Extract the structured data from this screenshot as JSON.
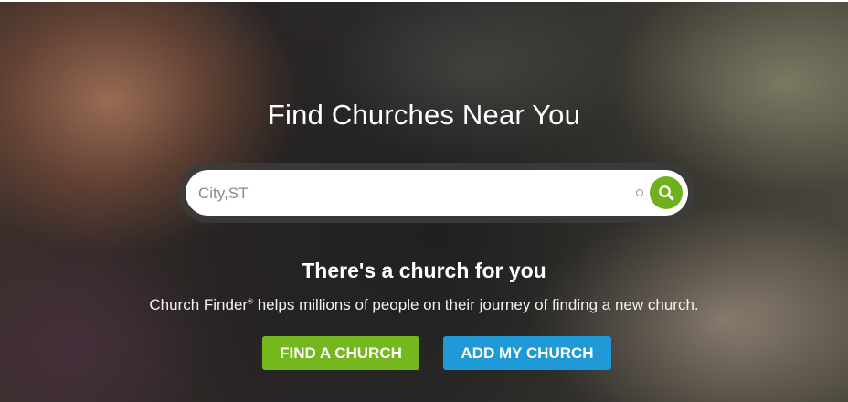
{
  "hero": {
    "title": "Find Churches Near You",
    "search": {
      "placeholder": "City,ST",
      "value": ""
    },
    "subtitle": "There's a church for you",
    "description": {
      "brand": "Church Finder",
      "mark": "®",
      "rest": " helps millions of people on their journey of finding a new church."
    },
    "buttons": {
      "find": "FIND A CHURCH",
      "add": "ADD MY CHURCH"
    }
  },
  "colors": {
    "green": "#75b81d",
    "blue": "#1f9ad6"
  },
  "icons": {
    "search": "search-icon",
    "location": "location-icon"
  }
}
